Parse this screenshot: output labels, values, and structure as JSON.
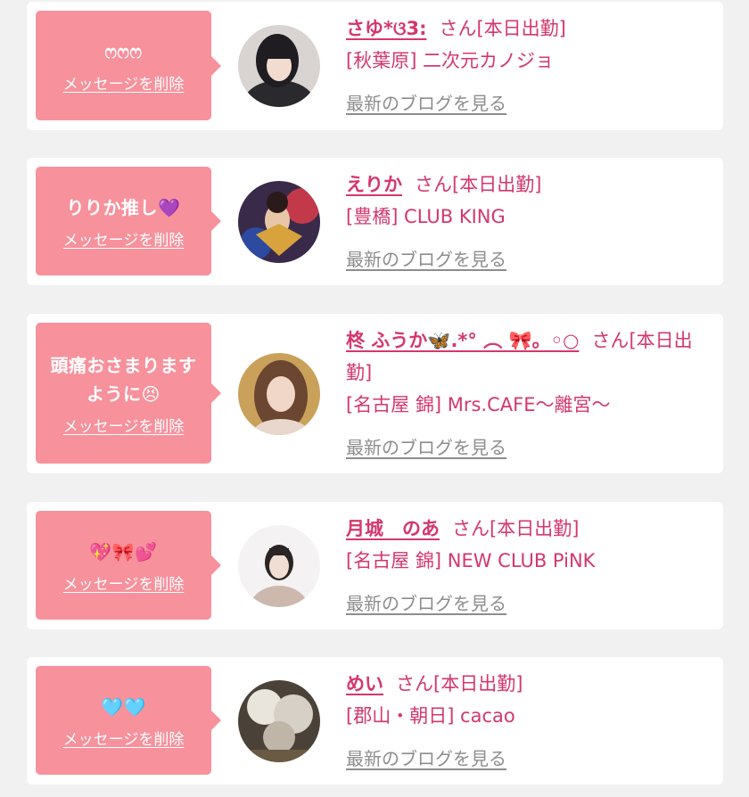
{
  "colors": {
    "accent": "#d5376b",
    "bubble": "#f7919c",
    "link_gray": "#8d8d8d",
    "background": "#f1f1f1"
  },
  "delete_label": "メッセージを削除",
  "blog_label": "最新のブログを見る",
  "honorific": "さん",
  "status": "[本日出勤]",
  "cards": [
    {
      "message": "ෆෆෆ",
      "name": "さゆ*ଓ3:",
      "location": "[秋葉原] 二次元カノジョ",
      "avatar": "avatar-photo"
    },
    {
      "message": "りりか推し💜",
      "name": "えりか",
      "location": "[豊橋] CLUB KING",
      "avatar": "avatar-photo"
    },
    {
      "message": "頭痛おさまりますように😣",
      "name": "柊 ふうか🦋.*° ︵ 🎀。◦○",
      "location": "[名古屋 錦] Mrs.CAFE〜離宮〜",
      "avatar": "avatar-photo"
    },
    {
      "message": "💖🎀💕",
      "name": "月城　のあ",
      "location": "[名古屋 錦] NEW CLUB PiNK",
      "avatar": "avatar-photo"
    },
    {
      "message": "🩵🩵",
      "name": "めい",
      "location": "[郡山・朝日] cacao",
      "avatar": "avatar-photo"
    }
  ]
}
